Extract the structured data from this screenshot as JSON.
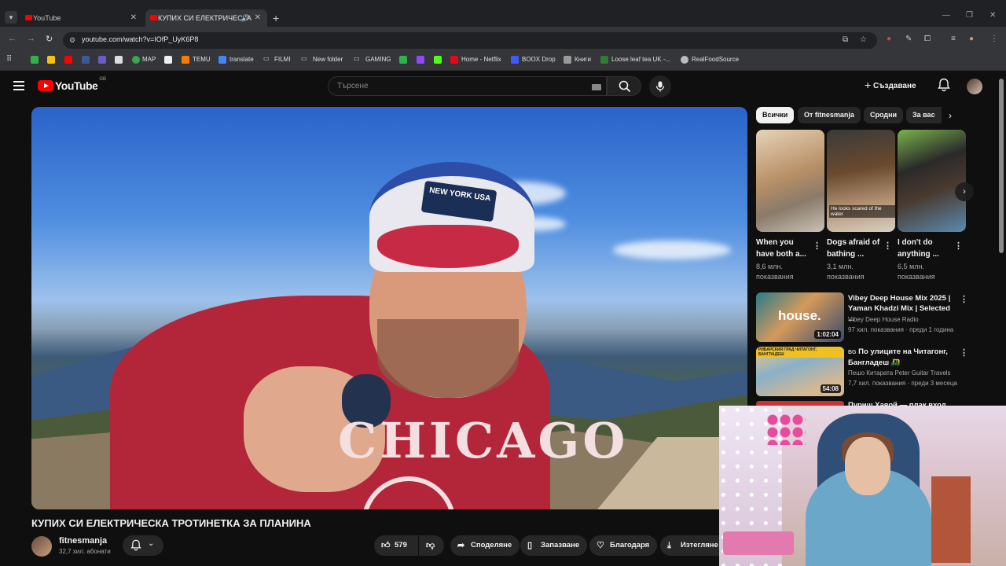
{
  "browser": {
    "tabs": [
      {
        "title": "YouTube"
      },
      {
        "title": "КУПИХ СИ ЕЛЕКТРИЧЕСКА"
      }
    ],
    "url": "youtube.com/watch?v=IOfP_UyK6P8",
    "bookmarks": [
      "MAP",
      "TEMU",
      "translate",
      "FILMI",
      "New folder",
      "GAMING",
      "Home - Netflix",
      "BOOX Drop",
      "Книги",
      "Loose leaf tea UK -...",
      "RealFoodSource"
    ]
  },
  "youtube": {
    "logo": "YouTube",
    "country": "GB",
    "search_placeholder": "Търсене",
    "create_label": "Създаване"
  },
  "video": {
    "title": "КУПИХ СИ ЕЛЕКТРИЧЕСКА ТРОТИНЕТКА ЗА ПЛАНИНА",
    "cap_text": "NEW YORK USA",
    "shirt_text": "CHICAGO",
    "channel": "fitnesmanja",
    "subscribers": "32,7 хил. абонати",
    "likes": "579",
    "share_label": "Споделяне",
    "save_label": "Запазване",
    "thanks_label": "Благодаря",
    "download_label": "Изтегляне"
  },
  "sidebar": {
    "chips": [
      "Всички",
      "От fitnesmanja",
      "Сродни",
      "За вас"
    ],
    "shorts": [
      {
        "title": "When you have both a...",
        "views": "8,6 млн. показвания",
        "caption": ""
      },
      {
        "title": "Dogs afraid of bathing ...",
        "views": "3,1 млн. показвания",
        "caption": "He looks scared of the water"
      },
      {
        "title": "I don't do anything ...",
        "views": "6,5 млн. показвания",
        "caption": ""
      }
    ],
    "recommendations": [
      {
        "title": "Vibey Deep House Mix 2025 | Yaman Khadzi Mix | Selected ...",
        "channel": "Vibey Deep House Radio",
        "meta": "97 хил. показвания · преди 1 година",
        "duration": "1:02:04",
        "thumb_text": "house."
      },
      {
        "title": "По улиците на Читагонг, Бангладеш 🛺",
        "channel": "Пешо Китарата Peter Guitar Travels",
        "meta": "7,7 хил. показвания · преди 3 месеца",
        "duration": "54:08",
        "thumb_text": "РИБАРСКИЯ ГРАД ЧИТАГОНГ, БАНГЛАДЕШ"
      },
      {
        "title": "Пуриш Хаяой — плак вход",
        "channel": "",
        "meta": "",
        "duration": "",
        "thumb_text": ""
      }
    ]
  }
}
